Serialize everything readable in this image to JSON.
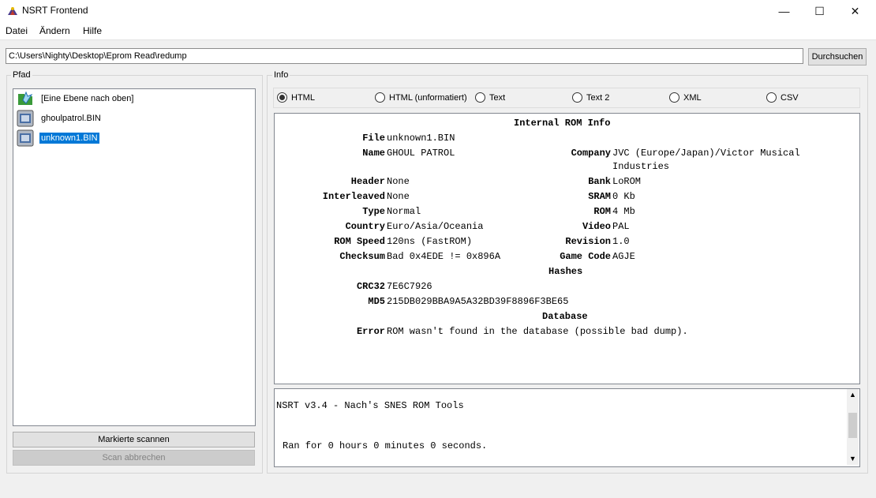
{
  "window": {
    "title": "NSRT Frontend",
    "minimize": "—",
    "maximize": "☐",
    "close": "✕"
  },
  "menu": {
    "items": [
      "Datei",
      "Ändern",
      "Hilfe"
    ]
  },
  "path": {
    "value": "C:\\Users\\Nighty\\Desktop\\Eprom Read\\redump",
    "browse_label": "Durchsuchen"
  },
  "pfad": {
    "title": "Pfad",
    "files": [
      {
        "label": "[Eine Ebene nach oben]",
        "icon": "folder-up-icon",
        "selected": false
      },
      {
        "label": "ghoulpatrol.BIN",
        "icon": "rom-file-icon",
        "selected": false
      },
      {
        "label": "unknown1.BIN",
        "icon": "rom-file-icon",
        "selected": true
      }
    ],
    "scan_label": "Markierte scannen",
    "abort_label": "Scan abbrechen"
  },
  "info": {
    "title": "Info",
    "formats": [
      "HTML",
      "HTML (unformatiert)",
      "Text",
      "Text 2",
      "XML",
      "CSV"
    ],
    "selected_format": "HTML",
    "heading": "Internal ROM Info",
    "file_label": "File",
    "file_value": "unknown1.BIN",
    "name_label": "Name",
    "name_value": "GHOUL PATROL",
    "company_label": "Company",
    "company_value_1": "JVC (Europe/Japan)/Victor Musical",
    "company_value_2": "Industries",
    "header_label": "Header",
    "header_value": "None",
    "bank_label": "Bank",
    "bank_value": "LoROM",
    "interleaved_label": "Interleaved",
    "interleaved_value": "None",
    "sram_label": "SRAM",
    "sram_value": "0 Kb",
    "type_label": "Type",
    "type_value": "Normal",
    "rom_label": "ROM",
    "rom_value": "4 Mb",
    "country_label": "Country",
    "country_value": "Euro/Asia/Oceania",
    "video_label": "Video",
    "video_value": "PAL",
    "speed_label": "ROM Speed",
    "speed_value": "120ns (FastROM)",
    "revision_label": "Revision",
    "revision_value": "1.0",
    "checksum_label": "Checksum",
    "checksum_value": "Bad 0x4EDE != 0x896A",
    "gamecode_label": "Game Code",
    "gamecode_value": "AGJE",
    "hashes_heading": "Hashes",
    "crc_label": "CRC32",
    "crc_value": "7E6C7926",
    "md5_label": "MD5",
    "md5_value": "215DB029BBA9A5A32BD39F8896F3BE65",
    "database_heading": "Database",
    "error_label": "Error",
    "error_value": "ROM wasn't found in the database (possible bad dump)."
  },
  "log": {
    "line1": "NSRT v3.4 - Nach's SNES ROM Tools",
    "line2": "Ran for 0 hours 0 minutes 0 seconds."
  }
}
